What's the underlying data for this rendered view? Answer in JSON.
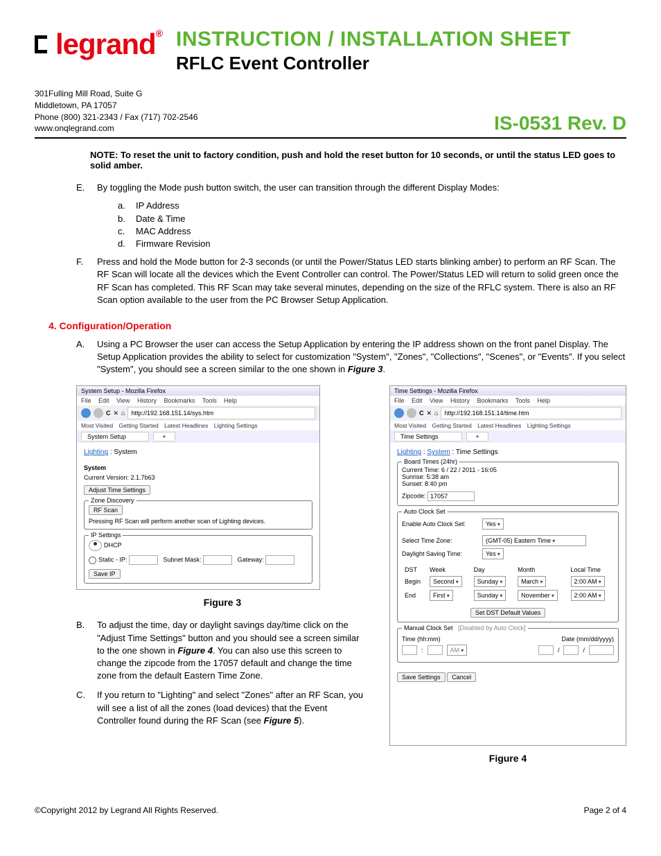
{
  "header": {
    "logo_text": "legrand",
    "title": "INSTRUCTION / INSTALLATION SHEET",
    "subtitle": "RFLC Event Controller"
  },
  "address": {
    "line1": "301Fulling Mill Road, Suite G",
    "line2": "Middletown, PA 17057",
    "line3": "Phone (800) 321-2343 / Fax (717) 702-2546",
    "line4": "www.onqlegrand.com"
  },
  "revision": "IS-0531 Rev. D",
  "note": "NOTE: To reset the unit to factory condition, push and hold the reset button for 10 seconds, or until the status LED goes to solid amber.",
  "itemE": {
    "marker": "E.",
    "text": "By toggling the Mode push button switch, the user can transition through the different Display Modes:",
    "subs": [
      {
        "marker": "a.",
        "text": "IP Address"
      },
      {
        "marker": "b.",
        "text": "Date & Time"
      },
      {
        "marker": "c.",
        "text": "MAC Address"
      },
      {
        "marker": "d.",
        "text": "Firmware Revision"
      }
    ]
  },
  "itemF": {
    "marker": "F.",
    "text": "Press and hold the Mode button for 2-3 seconds (or until the Power/Status LED starts blinking amber) to perform an RF Scan. The RF Scan will locate all the devices which the Event Controller can control. The Power/Status LED will return to solid green once the RF Scan has completed. This RF Scan may take several minutes, depending on the size of the RFLC system. There is also an RF Scan option available to the user from the PC Browser Setup Application."
  },
  "section4": {
    "heading": "4.   Configuration/Operation",
    "A": {
      "marker": "A.",
      "text": "Using a PC Browser the user can access the Setup Application by entering the IP address shown on the front panel Display. The Setup Application provides the ability to select for customization \"System\", \"Zones\", \"Collections\", \"Scenes\", or \"Events\". If you select \"System\", you should see a screen similar to the one shown in ",
      "bold": "Figure 3",
      "tail": "."
    },
    "B": {
      "marker": "B.",
      "text": "To adjust the time, day or daylight savings day/time click on the \"Adjust Time Settings\" button and you should see a screen similar to the one shown in ",
      "bold": "Figure 4",
      "tail": ". You can also use this screen to change the zipcode from the 17057 default and change the time zone from the default Eastern Time Zone."
    },
    "C": {
      "marker": "C.",
      "text": "If you return to \"Lighting\" and select \"Zones\" after an RF Scan, you will see a list of all the zones (load devices) that the Event Controller found during the RF Scan (see ",
      "bold": "Figure 5",
      "tail": ")."
    }
  },
  "figure3": {
    "caption": "Figure 3",
    "window_title": "System Setup - Mozilla Firefox",
    "menu": [
      "File",
      "Edit",
      "View",
      "History",
      "Bookmarks",
      "Tools",
      "Help"
    ],
    "url": "http://192.168.151.14/sys.htm",
    "bookmarks": [
      "Most Visited",
      "Getting Started",
      "Latest Headlines",
      "Lighting Settings"
    ],
    "tab": "System Setup",
    "breadcrumb": {
      "a": "Lighting",
      "sep": " : ",
      "b": "System"
    },
    "system_label": "System",
    "version_label": "Current Version:",
    "version": "2.1.7b63",
    "adjust_btn": "Adjust Time Settings",
    "zone_discovery": "Zone Discovery",
    "rfscan_btn": "RF Scan",
    "rfscan_note": "Pressing RF Scan will perform another scan of Lighting devices.",
    "ip_settings": "IP Settings",
    "dhcp": "DHCP",
    "static": "Static - IP:",
    "subnet": "Subnet Mask:",
    "gateway": "Gateway:",
    "save_ip": "Save IP"
  },
  "figure4": {
    "caption": "Figure 4",
    "window_title": "Time Settings - Mozilla Firefox",
    "menu": [
      "File",
      "Edit",
      "View",
      "History",
      "Bookmarks",
      "Tools",
      "Help"
    ],
    "url": "http://192.168.151.14/time.htm",
    "bookmarks": [
      "Most Visited",
      "Getting Started",
      "Latest Headlines",
      "Lighting Settings"
    ],
    "tab": "Time Settings",
    "breadcrumb": {
      "a": "Lighting",
      "b": "System",
      "c": "Time Settings"
    },
    "board_times": "Board Times (24hr)",
    "current_time": "Current Time: 6 / 22 / 2011 - 16:05",
    "sunrise": "Sunrise: 5:38 am",
    "sunset": "Sunset: 8:40 pm",
    "zip_label": "Zipcode:",
    "zip": "17057",
    "auto_clock": "Auto Clock Set",
    "enable_auto": "Enable Auto Clock Set:",
    "enable_val": "Yes",
    "tz_label": "Select Time Zone:",
    "tz_val": "(GMT-05) Eastern Time",
    "dst_label": "Daylight Saving Time:",
    "dst_val": "Yes",
    "dst_table": {
      "headers": [
        "DST",
        "Week",
        "Day",
        "Month",
        "Local Time"
      ],
      "rows": [
        {
          "label": "Begin",
          "week": "Second",
          "day": "Sunday",
          "month": "March",
          "time": "2:00 AM"
        },
        {
          "label": "End",
          "week": "First",
          "day": "Sunday",
          "month": "November",
          "time": "2:00 AM"
        }
      ]
    },
    "set_dst_btn": "Set DST Default Values",
    "manual_clock": "Manual Clock Set",
    "manual_note": "[Disabled by Auto Clock]",
    "time_hdr": "Time (hh:mm)",
    "date_hdr": "Date (mm/dd/yyyy)",
    "ampm": "AM",
    "save_btn": "Save Settings",
    "cancel_btn": "Cancel"
  },
  "footer": {
    "copyright": "©Copyright 2012 by Legrand All Rights Reserved.",
    "page": "Page 2 of 4"
  }
}
